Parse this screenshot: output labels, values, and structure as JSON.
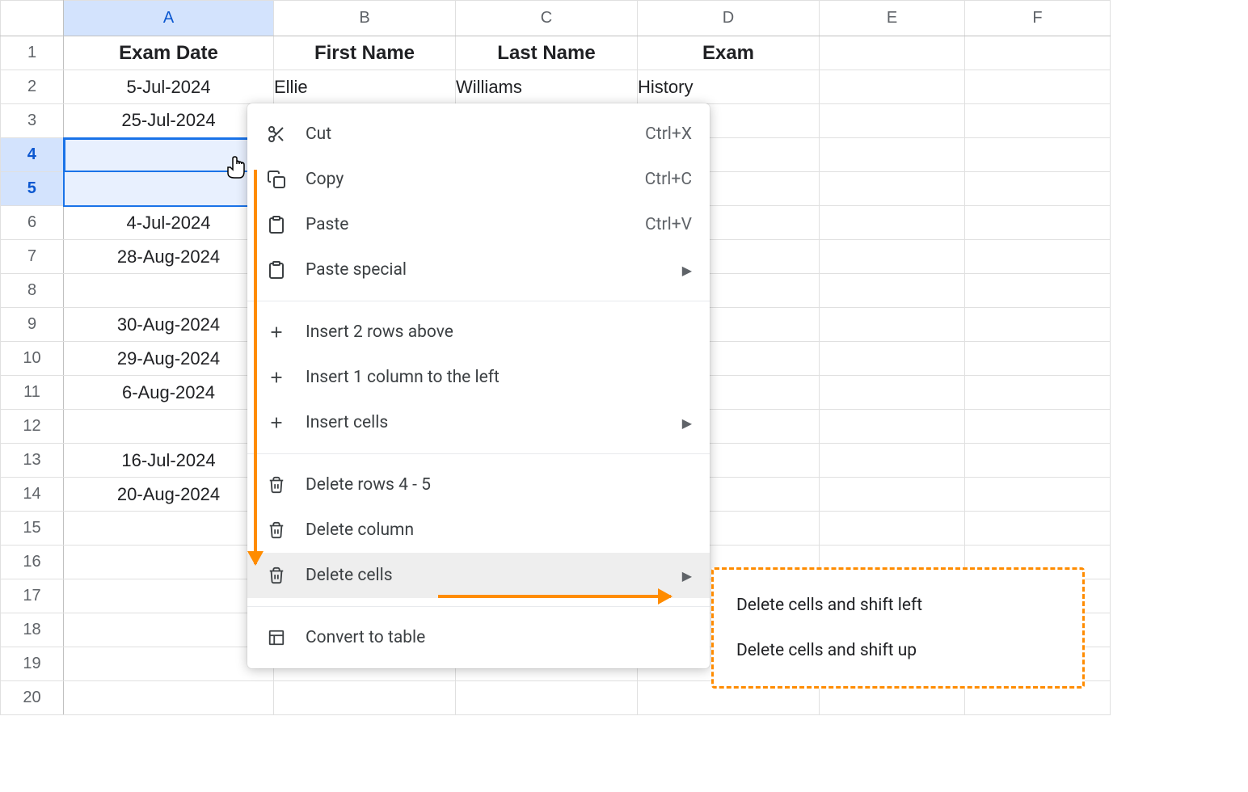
{
  "columns": [
    "A",
    "B",
    "C",
    "D",
    "E",
    "F"
  ],
  "selected_column": "A",
  "selected_rows": [
    4,
    5
  ],
  "row_count": 20,
  "headers": {
    "a": "Exam Date",
    "b": "First Name",
    "c": "Last Name",
    "d": "Exam"
  },
  "rows": {
    "2": {
      "a": "5-Jul-2024",
      "b": "Ellie",
      "c": "Williams",
      "d": "History"
    },
    "3": {
      "a": "25-Jul-2024"
    },
    "6": {
      "a": "4-Jul-2024"
    },
    "7": {
      "a": "28-Aug-2024"
    },
    "9": {
      "a": "30-Aug-2024"
    },
    "10": {
      "a": "29-Aug-2024"
    },
    "11": {
      "a": "6-Aug-2024"
    },
    "13": {
      "a": "16-Jul-2024"
    },
    "14": {
      "a": "20-Aug-2024"
    }
  },
  "context_menu": {
    "cut": {
      "label": "Cut",
      "shortcut": "Ctrl+X"
    },
    "copy": {
      "label": "Copy",
      "shortcut": "Ctrl+C"
    },
    "paste": {
      "label": "Paste",
      "shortcut": "Ctrl+V"
    },
    "paste_special": {
      "label": "Paste special"
    },
    "insert_rows_above": {
      "label": "Insert 2 rows above"
    },
    "insert_col_left": {
      "label": "Insert 1 column to the left"
    },
    "insert_cells": {
      "label": "Insert cells"
    },
    "delete_rows": {
      "label": "Delete rows 4 - 5"
    },
    "delete_column": {
      "label": "Delete column"
    },
    "delete_cells": {
      "label": "Delete cells"
    },
    "convert_table": {
      "label": "Convert to table"
    }
  },
  "submenu": {
    "shift_left": "Delete cells and shift left",
    "shift_up": "Delete cells and shift up"
  }
}
